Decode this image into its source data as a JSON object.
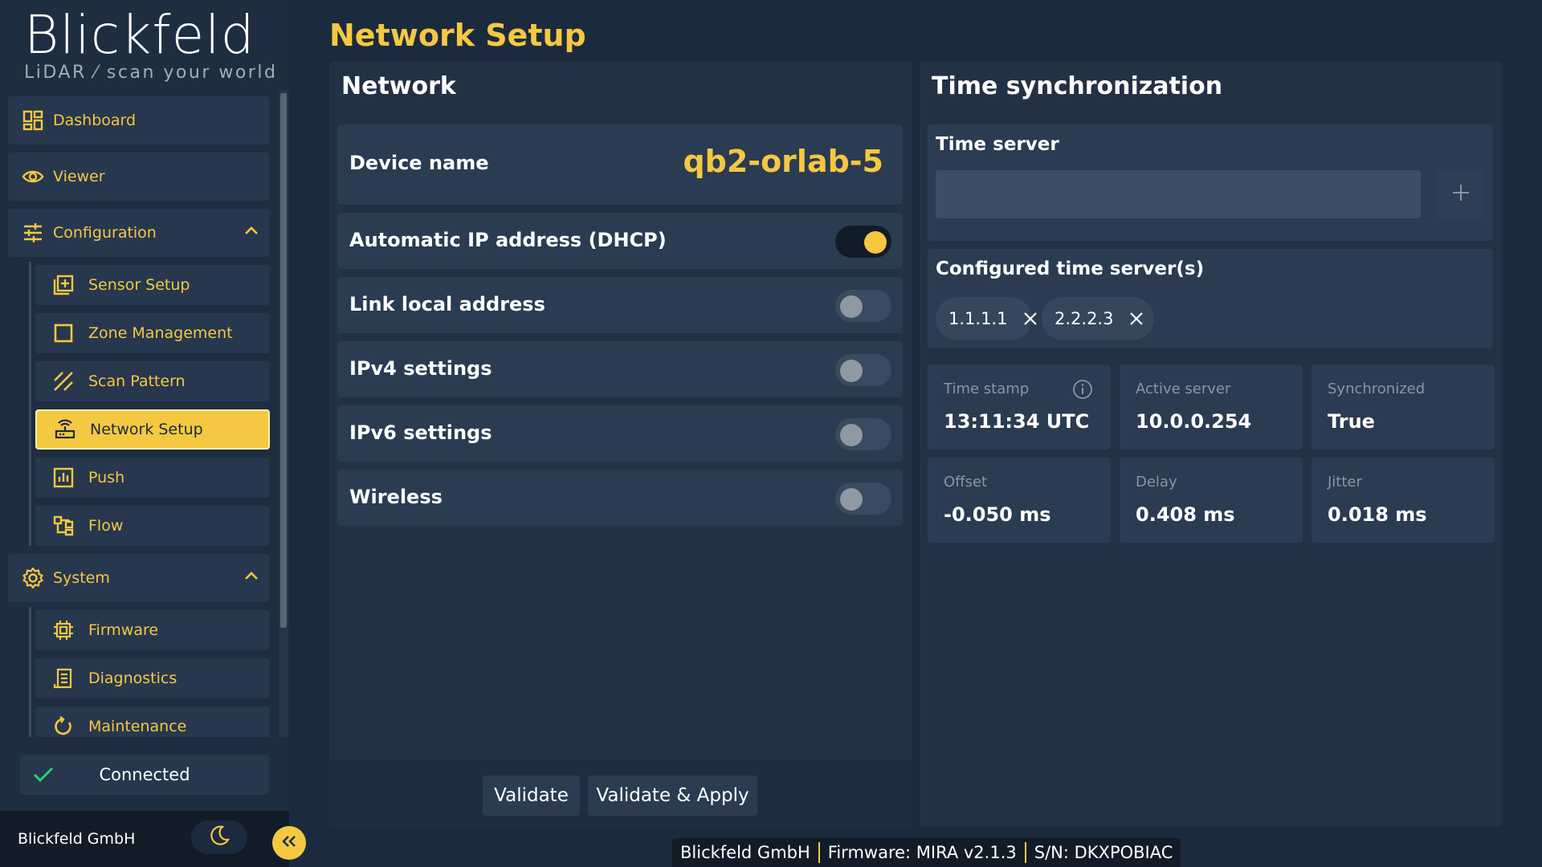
{
  "sidebar": {
    "logo": {
      "wordmark": "Blickfeld",
      "tagline": "LiDAR ⁄ scan your world"
    },
    "items": {
      "dashboard": {
        "label": "Dashboard",
        "icon": "dashboard-icon"
      },
      "viewer": {
        "label": "Viewer",
        "icon": "eye-icon"
      },
      "configuration": {
        "label": "Configuration",
        "icon": "sliders-icon",
        "expanded": true
      },
      "sensor_setup": {
        "label": "Sensor Setup",
        "icon": "sensor-setup-icon"
      },
      "zone_management": {
        "label": "Zone Management",
        "icon": "square-icon"
      },
      "scan_pattern": {
        "label": "Scan Pattern",
        "icon": "scan-pattern-icon"
      },
      "network_setup": {
        "label": "Network Setup",
        "icon": "router-icon",
        "active": true
      },
      "push": {
        "label": "Push",
        "icon": "push-chart-icon"
      },
      "flow": {
        "label": "Flow",
        "icon": "flow-icon"
      },
      "system": {
        "label": "System",
        "icon": "gear-icon",
        "expanded": true
      },
      "firmware": {
        "label": "Firmware",
        "icon": "chip-icon"
      },
      "diagnostics": {
        "label": "Diagnostics",
        "icon": "report-icon"
      },
      "maintenance": {
        "label": "Maintenance",
        "icon": "refresh-icon"
      }
    },
    "connection_status": "Connected",
    "footer_company": "Blickfeld GmbH"
  },
  "page": {
    "title": "Network Setup"
  },
  "network": {
    "title": "Network",
    "device_name_label": "Device name",
    "device_name_value": "qb2-orlab-5",
    "toggles": [
      {
        "label": "Automatic IP address (DHCP)",
        "on": true
      },
      {
        "label": "Link local address",
        "on": false
      },
      {
        "label": "IPv4 settings",
        "on": false
      },
      {
        "label": "IPv6 settings",
        "on": false
      },
      {
        "label": "Wireless",
        "on": false
      }
    ],
    "validate_label": "Validate",
    "validate_apply_label": "Validate & Apply"
  },
  "time_sync": {
    "title": "Time synchronization",
    "time_server_label": "Time server",
    "time_server_value": "",
    "configured_label": "Configured time server(s)",
    "servers": [
      "1.1.1.1",
      "2.2.2.3"
    ],
    "stats": [
      {
        "key": "Time stamp",
        "value": "13:11:34 UTC"
      },
      {
        "key": "Active server",
        "value": "10.0.0.254"
      },
      {
        "key": "Synchronized",
        "value": "True"
      },
      {
        "key": "Offset",
        "value": "-0.050 ms"
      },
      {
        "key": "Delay",
        "value": "0.408 ms"
      },
      {
        "key": "Jitter",
        "value": "0.018 ms"
      }
    ]
  },
  "status_bar": {
    "company": "Blickfeld GmbH",
    "firmware": "Firmware: MIRA v2.1.3",
    "serial": "S/N: DKXPOBIAC"
  },
  "colors": {
    "accent": "#f5c842",
    "background": "#1c2a3d",
    "card": "#2b3b51",
    "success": "#2ecc71"
  }
}
